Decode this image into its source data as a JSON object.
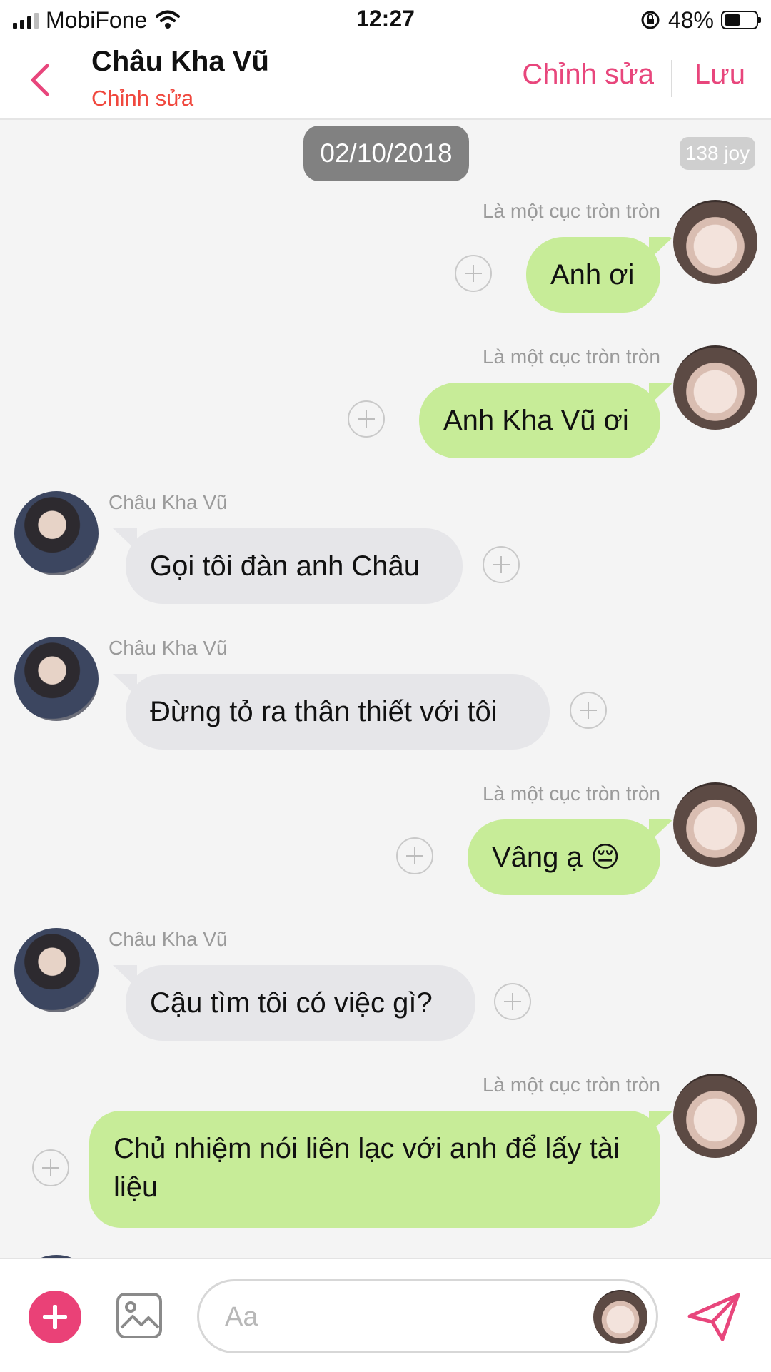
{
  "status_bar": {
    "carrier": "MobiFone",
    "time": "12:27",
    "battery": "48%",
    "battery_level": 0.48
  },
  "header": {
    "name": "Châu Kha Vũ",
    "subtitle": "Chỉnh sửa",
    "edit_label": "Chỉnh sửa",
    "save_label": "Lưu",
    "accent_color": "#e8467c"
  },
  "chat": {
    "date": "02/10/2018",
    "joy_badge": "138 joy",
    "messages": [
      {
        "sender": "Là một cục tròn tròn",
        "text": "Anh ơi",
        "direction": "out"
      },
      {
        "sender": "Là một cục tròn tròn",
        "text": "Anh Kha Vũ ơi",
        "direction": "out"
      },
      {
        "sender": "Châu Kha Vũ",
        "text": "Gọi tôi đàn anh Châu",
        "direction": "in"
      },
      {
        "sender": "Châu Kha Vũ",
        "text": "Đừng tỏ ra thân thiết với tôi",
        "direction": "in"
      },
      {
        "sender": "Là một cục tròn tròn",
        "text": "Vâng ạ 😔",
        "direction": "out"
      },
      {
        "sender": "Châu Kha Vũ",
        "text": "Cậu tìm tôi có việc gì?",
        "direction": "in"
      },
      {
        "sender": "Là một cục tròn tròn",
        "text": "Chủ nhiệm nói liên lạc với anh để lấy tài liệu",
        "direction": "out"
      }
    ]
  },
  "composer": {
    "placeholder": "Aa",
    "icons": [
      "plus-icon",
      "image-icon",
      "sticker-icon",
      "send-icon"
    ]
  },
  "colors": {
    "outgoing_bubble": "#c7ec98",
    "incoming_bubble": "#e6e6e9",
    "add_button": "#ea4177"
  }
}
